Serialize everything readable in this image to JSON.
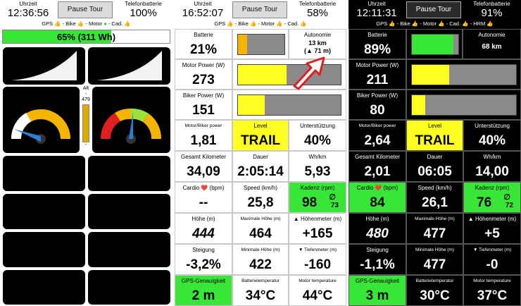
{
  "panel1": {
    "header": {
      "time_label": "Uhrzeit",
      "time": "12:36:56",
      "pause": "Pause Tour",
      "phone_label": "Telefonbatterie",
      "phone_value": "100%"
    },
    "sensors": {
      "gps": "GPS",
      "bike": "- Bike",
      "motor": "- Motor",
      "cad": "- Cad."
    },
    "battery_text": "65% (311 Wh)",
    "battery_fraction": 0.65,
    "alt_label": "Alt",
    "alt_dash": "-",
    "alt_value": "479",
    "alt_dash2": "-"
  },
  "panel2": {
    "header": {
      "time_label": "Uhrzeit",
      "time": "16:52:07",
      "pause": "Pause Tour",
      "phone_label": "Telefonbatterie",
      "phone_value": "58%"
    },
    "sensors": {
      "gps": "GPS",
      "bike": "- Bike",
      "motor": "- Motor",
      "cad": "- Cad."
    },
    "batterie": {
      "label": "Batterie",
      "value": "21%",
      "fill": 0.2
    },
    "autonomie": {
      "label": "Autonomie",
      "value": "13 km",
      "sub": "(▲ 71 m)"
    },
    "motor": {
      "label": "Motor Power (W)",
      "value": "273",
      "fill": 0.47
    },
    "biker": {
      "label": "Biker Power (W)",
      "value": "151",
      "fill": 0.26
    },
    "rows": [
      [
        {
          "label": "Motor/Biker power",
          "value": "1,81"
        },
        {
          "label": "Level",
          "value": "TRAIL"
        },
        {
          "label": "Unterstützung",
          "value": "40%"
        }
      ],
      [
        {
          "label": "Gesamt Kilometer",
          "value": "34,09"
        },
        {
          "label": "Dauer",
          "value": "2:05:14"
        },
        {
          "label": "Wh/km",
          "value": "5,93"
        }
      ],
      [
        {
          "label": "Cardio ❤️ (bpm)",
          "value": "--"
        },
        {
          "label": "Speed (km/h)",
          "value": "25,8"
        },
        {
          "label": "Kadenz (rpm)",
          "value": "98",
          "sub": "∅",
          "sub2": "73"
        }
      ],
      [
        {
          "label": "Höhe (m)",
          "value": "444"
        },
        {
          "label": "Maximale Höhe (m)",
          "value": "464"
        },
        {
          "label": "▲ Höhenmeter (m)",
          "value": "+165"
        }
      ],
      [
        {
          "label": "Steigung",
          "value": "-3,2%"
        },
        {
          "label": "Minimale Höhe (m)",
          "value": "422"
        },
        {
          "label": "▼ Tiefenmeter (m)",
          "value": "-160"
        }
      ],
      [
        {
          "label": "GPS-Genauigkeit",
          "value": "2 m"
        },
        {
          "label": "Batterietemperatur",
          "value": "34°C"
        },
        {
          "label": "Motor temperature",
          "value": "44°C"
        }
      ]
    ]
  },
  "panel3": {
    "header": {
      "time_label": "Uhrzeit",
      "time": "12:11:31",
      "pause": "Pause Tour",
      "phone_label": "Telefonbatterie",
      "phone_value": "91%"
    },
    "sensors": {
      "gps": "GPS",
      "bike": "- Bike",
      "motor": "- Motor",
      "cad": "- Cad.",
      "hrm": "- HRM"
    },
    "batterie": {
      "label": "Batterie",
      "value": "89%",
      "fill": 0.89
    },
    "autonomie": {
      "label": "Autonomie",
      "value": "68 km"
    },
    "motor": {
      "label": "Motor Power (W)",
      "value": "211",
      "fill": 0.36
    },
    "biker": {
      "label": "Biker Power (W)",
      "value": "80",
      "fill": 0.13
    },
    "rows": [
      [
        {
          "label": "Motor/Biker power",
          "value": "2,64"
        },
        {
          "label": "Level",
          "value": "TRAIL"
        },
        {
          "label": "Unterstützung",
          "value": "40%"
        }
      ],
      [
        {
          "label": "Gesamt Kilometer",
          "value": "2,01"
        },
        {
          "label": "Dauer",
          "value": "06:05"
        },
        {
          "label": "Wh/km",
          "value": "14,00"
        }
      ],
      [
        {
          "label": "Cardio ❤️ (bpm)",
          "value": "84"
        },
        {
          "label": "Speed (km/h)",
          "value": "26,1"
        },
        {
          "label": "Kadenz (rpm)",
          "value": "76",
          "sub": "∅",
          "sub2": "72"
        }
      ],
      [
        {
          "label": "Höhe (m)",
          "value": "480"
        },
        {
          "label": "Maximale Höhe (m)",
          "value": "477"
        },
        {
          "label": "▲ Höhenmeter (m)",
          "value": "+5"
        }
      ],
      [
        {
          "label": "Steigung",
          "value": "-1,1%"
        },
        {
          "label": "Minimale Höhe (m)",
          "value": "477"
        },
        {
          "label": "▼ Tiefenmeter (m)",
          "value": "-0"
        }
      ],
      [
        {
          "label": "GPS-Genauigkeit",
          "value": "3 m"
        },
        {
          "label": "Batterietemperatur",
          "value": "30°C"
        },
        {
          "label": "Motor temperature",
          "value": "37°C"
        }
      ]
    ]
  },
  "colors": {
    "green": "#37e637",
    "yellow": "#ffff22",
    "orange_gauge": "#f4b400",
    "needle": "#2a7fd4",
    "red": "#e02020"
  }
}
